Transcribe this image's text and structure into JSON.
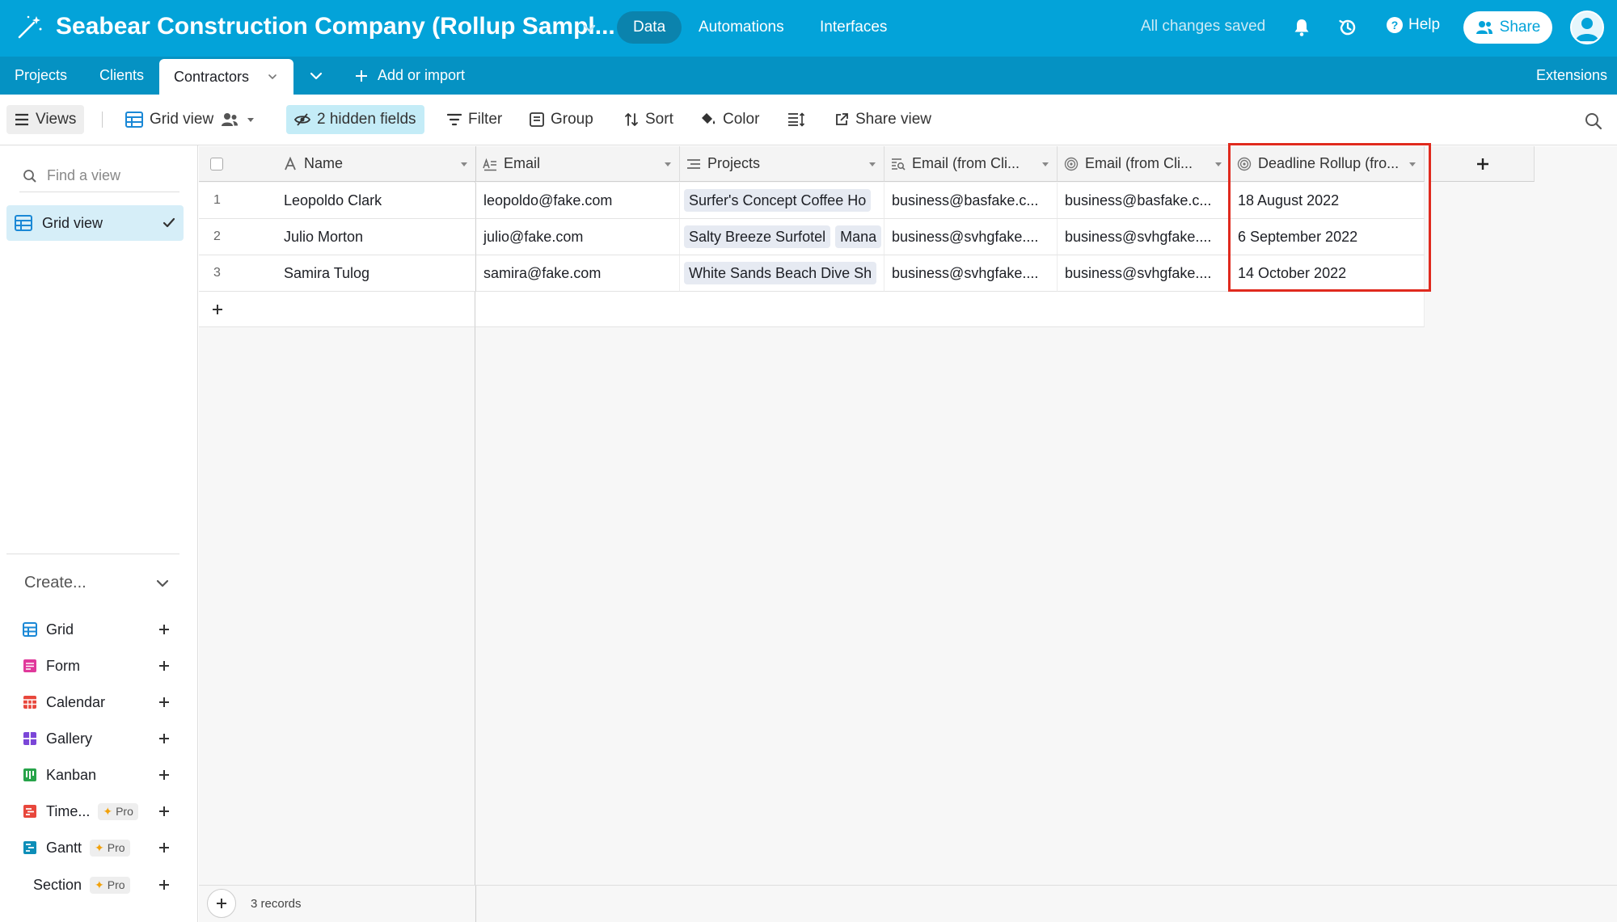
{
  "app": {
    "base_title": "Seabear Construction Company (Rollup Sampl...",
    "nav": [
      "Data",
      "Automations",
      "Interfaces"
    ],
    "saved_status": "All changes saved",
    "help_label": "Help",
    "share_label": "Share",
    "accent_color": "#03a3d9"
  },
  "tables": {
    "tabs": [
      "Projects",
      "Clients",
      "Contractors"
    ],
    "active": "Contractors",
    "add_or_import": "Add or import",
    "extensions": "Extensions"
  },
  "viewbar": {
    "views": "Views",
    "current_view": "Grid view",
    "hidden_fields": "2 hidden fields",
    "filter": "Filter",
    "group": "Group",
    "sort": "Sort",
    "color": "Color",
    "share_view": "Share view"
  },
  "sidebar": {
    "find_placeholder": "Find a view",
    "views": [
      "Grid view"
    ],
    "create_label": "Create...",
    "create_items": [
      {
        "label": "Grid",
        "icon": "grid-icon",
        "color": "#1a88d6"
      },
      {
        "label": "Form",
        "icon": "form-icon",
        "color": "#e0399b"
      },
      {
        "label": "Calendar",
        "icon": "calendar-icon",
        "color": "#e8473c"
      },
      {
        "label": "Gallery",
        "icon": "gallery-icon",
        "color": "#7b46d8"
      },
      {
        "label": "Kanban",
        "icon": "kanban-icon",
        "color": "#27a34a"
      },
      {
        "label": "Time...",
        "icon": "timeline-icon",
        "color": "#e8473c",
        "badge": "Pro"
      },
      {
        "label": "Gantt",
        "icon": "gantt-icon",
        "color": "#0d8eb8",
        "badge": "Pro"
      },
      {
        "label": "Section",
        "icon": "",
        "badge": "Pro"
      }
    ]
  },
  "grid": {
    "columns": [
      {
        "label": "Name",
        "icon": "text-field-icon"
      },
      {
        "label": "Email",
        "icon": "long-text-icon"
      },
      {
        "label": "Projects",
        "icon": "linked-record-icon"
      },
      {
        "label": "Email (from Cli...",
        "icon": "lookup-icon"
      },
      {
        "label": "Email (from Cli...",
        "icon": "rollup-icon"
      },
      {
        "label": "Deadline Rollup (fro...",
        "icon": "rollup-icon"
      }
    ],
    "rows": [
      {
        "num": "1",
        "name": "Leopoldo Clark",
        "email": "leopoldo@fake.com",
        "projects": [
          "Surfer's Concept Coffee Ho"
        ],
        "email_lookup": "business@basfake.c...",
        "email_rollup": "business@basfake.c...",
        "deadline": "18 August 2022"
      },
      {
        "num": "2",
        "name": "Julio Morton",
        "email": "julio@fake.com",
        "projects": [
          "Salty Breeze Surfotel",
          "Mana"
        ],
        "email_lookup": "business@svhgfake....",
        "email_rollup": "business@svhgfake....",
        "deadline": "6 September 2022"
      },
      {
        "num": "3",
        "name": "Samira Tulog",
        "email": "samira@fake.com",
        "projects": [
          "White Sands Beach Dive Sh"
        ],
        "email_lookup": "business@svhgfake....",
        "email_rollup": "business@svhgfake....",
        "deadline": "14 October 2022"
      }
    ],
    "record_count": "3 records",
    "highlight_color": "#e02a1e"
  }
}
